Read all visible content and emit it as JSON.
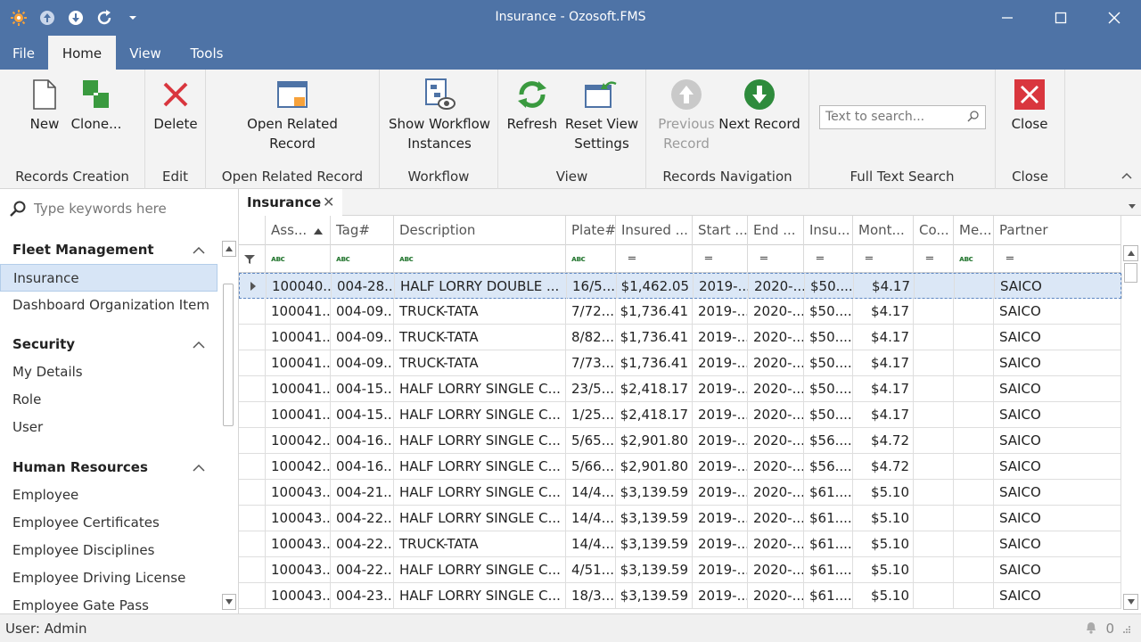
{
  "window": {
    "title": "Insurance - Ozosoft.FMS"
  },
  "menu_tabs": [
    "File",
    "Home",
    "View",
    "Tools"
  ],
  "ribbon": {
    "new_label": "New",
    "clone_label": "Clone...",
    "records_creation_label": "Records Creation",
    "delete_label": "Delete",
    "edit_label": "Edit",
    "open_related_line1": "Open Related",
    "open_related_line2": "Record",
    "open_related_group_label": "Open Related Record",
    "show_workflow_line1": "Show Workflow",
    "show_workflow_line2": "Instances",
    "workflow_label": "Workflow",
    "refresh_label": "Refresh",
    "reset_view_line1": "Reset View",
    "reset_view_line2": "Settings",
    "view_label": "View",
    "previous_line1": "Previous",
    "previous_line2": "Record",
    "next_record_label": "Next Record",
    "records_navigation_label": "Records Navigation",
    "search_placeholder": "Text to search...",
    "full_text_search_label": "Full Text Search",
    "close_label": "Close",
    "close_group_label": "Close",
    "colors": {
      "accent": "#4e73a6",
      "green": "#3a9a3f",
      "red": "#d9363e"
    }
  },
  "nav": {
    "search_placeholder": "Type keywords here",
    "groups": [
      {
        "title": "Fleet Management",
        "items": [
          "Insurance",
          "Dashboard Organization Item"
        ]
      },
      {
        "title": "Security",
        "items": [
          "My Details",
          "Role",
          "User"
        ]
      },
      {
        "title": "Human Resources",
        "items": [
          "Employee",
          "Employee Certificates",
          "Employee Disciplines",
          "Employee Driving License",
          "Employee Gate Pass"
        ]
      }
    ]
  },
  "doc_tab": {
    "title": "Insurance"
  },
  "grid": {
    "columns": [
      "Ass...",
      "Tag#",
      "Description",
      "Plate#",
      "Insured ...",
      "Start ...",
      "End ...",
      "Insu...",
      "Mont...",
      "Co...",
      "Me...",
      "Partner"
    ],
    "rows": [
      [
        "100040...",
        "004-28...",
        "HALF LORRY   DOUBLE ...",
        "16/5...",
        "$1,462.05",
        "2019-...",
        "2020-...",
        "$50....",
        "$4.17",
        "",
        "",
        "SAICO"
      ],
      [
        "100041...",
        "004-09...",
        " TRUCK-TATA",
        "7/72...",
        "$1,736.41",
        "2019-...",
        "2020-...",
        "$50....",
        "$4.17",
        "",
        "",
        "SAICO"
      ],
      [
        "100041...",
        "004-09...",
        " TRUCK-TATA",
        "8/82...",
        "$1,736.41",
        "2019-...",
        "2020-...",
        "$50....",
        "$4.17",
        "",
        "",
        "SAICO"
      ],
      [
        "100041...",
        "004-09...",
        " TRUCK-TATA",
        "7/73...",
        "$1,736.41",
        "2019-...",
        "2020-...",
        "$50....",
        "$4.17",
        "",
        "",
        "SAICO"
      ],
      [
        "100041...",
        "004-15...",
        "HALF LORRY SINGLE C...",
        "23/5...",
        "$2,418.17",
        "2019-...",
        "2020-...",
        "$50....",
        "$4.17",
        "",
        "",
        "SAICO"
      ],
      [
        "100041...",
        "004-15...",
        "HALF LORRY SINGLE C...",
        "1/25...",
        "$2,418.17",
        "2019-...",
        "2020-...",
        "$50....",
        "$4.17",
        "",
        "",
        "SAICO"
      ],
      [
        "100042...",
        "004-16...",
        "HALF LORRY SINGLE C...",
        "5/65...",
        "$2,901.80",
        "2019-...",
        "2020-...",
        "$56....",
        "$4.72",
        "",
        "",
        "SAICO"
      ],
      [
        "100042...",
        "004-16...",
        "HALF LORRY SINGLE C...",
        "5/66...",
        "$2,901.80",
        "2019-...",
        "2020-...",
        "$56....",
        "$4.72",
        "",
        "",
        "SAICO"
      ],
      [
        "100043...",
        "004-21...",
        "HALF LORRY SINGLE C...",
        "14/4...",
        "$3,139.59",
        "2019-...",
        "2020-...",
        "$61....",
        "$5.10",
        "",
        "",
        "SAICO"
      ],
      [
        "100043...",
        "004-22...",
        "HALF LORRY SINGLE C...",
        "14/4...",
        "$3,139.59",
        "2019-...",
        "2020-...",
        "$61....",
        "$5.10",
        "",
        "",
        "SAICO"
      ],
      [
        "100043...",
        "004-22...",
        " TRUCK-TATA",
        "14/4...",
        "$3,139.59",
        "2019-...",
        "2020-...",
        "$61....",
        "$5.10",
        "",
        "",
        "SAICO"
      ],
      [
        "100043...",
        "004-22...",
        "HALF LORRY SINGLE C...",
        "4/51...",
        "$3,139.59",
        "2019-...",
        "2020-...",
        "$61....",
        "$5.10",
        "",
        "",
        "SAICO"
      ],
      [
        "100043...",
        "004-23...",
        "HALF LORRY SINGLE C...",
        "18/3...",
        "$3,139.59",
        "2019-...",
        "2020-...",
        "$61....",
        "$5.10",
        "",
        "",
        "SAICO"
      ]
    ]
  },
  "status": {
    "user": "User: Admin",
    "notifications": "0"
  }
}
